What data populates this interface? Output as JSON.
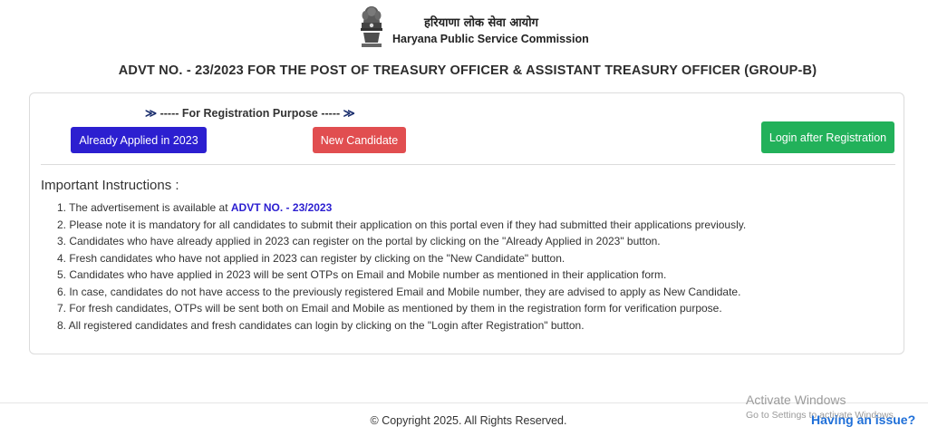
{
  "header": {
    "emblem_icon": "national-emblem-icon",
    "org_name_hindi": "हरियाणा लोक सेवा आयोग",
    "org_name_english": "Haryana Public Service Commission"
  },
  "page_title": "ADVT NO. - 23/2023 FOR THE POST OF TREASURY OFFICER & ASSISTANT TREASURY OFFICER (GROUP-B)",
  "registration": {
    "purpose_label": "----- For Registration Purpose -----",
    "already_applied_label": "Already Applied in 2023",
    "new_candidate_label": "New Candidate",
    "login_label": "Login after Registration"
  },
  "instructions": {
    "heading": "Important Instructions :",
    "item1_prefix": "1. The advertisement is available at ",
    "item1_link": "ADVT NO. - 23/2023",
    "items": [
      "2. Please note it is mandatory for all candidates to submit their application on this portal even if they had submitted their applications previously.",
      "3. Candidates who have already applied in 2023 can register on the portal by clicking on the \"Already Applied in 2023\" button.",
      "4. Fresh candidates who have not applied in 2023 can register by clicking on the \"New Candidate\" button.",
      "5. Candidates who have applied in 2023 will be sent OTPs on Email and Mobile number as mentioned in their application form.",
      "6. In case, candidates do not have access to the previously registered Email and Mobile number, they are advised to apply as New Candidate.",
      "7. For fresh candidates, OTPs will be sent both on Email and Mobile as mentioned by them in the registration form for verification purpose.",
      "8. All registered candidates and fresh candidates can login by clicking on the \"Login after Registration\" button."
    ]
  },
  "footer": {
    "copyright": "© Copyright 2025. All Rights Reserved.",
    "having_issue": "Having an issue?"
  },
  "os_overlay": {
    "activate_title": "Activate Windows",
    "activate_subtitle": "Go to Settings to activate Windows."
  },
  "colors": {
    "primary_blue": "#2c1fd0",
    "danger_red": "#e14e50",
    "success_green": "#22b15a"
  }
}
